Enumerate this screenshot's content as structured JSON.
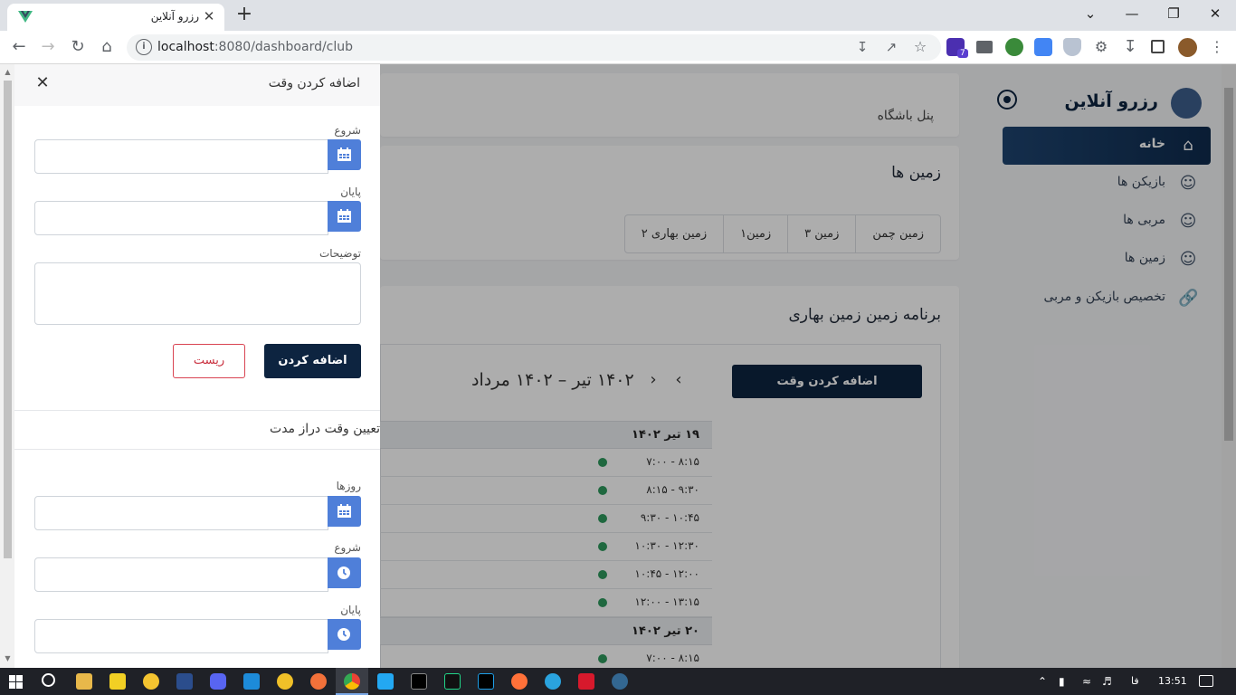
{
  "browser": {
    "tab_title": "رزرو آنلاین",
    "tab_close": "✕",
    "new_tab": "+",
    "url_host": "localhost",
    "url_rest": ":8080/dashboard/club",
    "window_controls": [
      "⌄",
      "—",
      "❐",
      "✕"
    ],
    "extension_badge": "7"
  },
  "sidebar": {
    "brand": "رزرو آنلاین",
    "items": [
      {
        "label": "خانه",
        "icon": "home-icon",
        "active": true
      },
      {
        "label": "بازیکن ها",
        "icon": "users-icon",
        "active": false
      },
      {
        "label": "مربی ها",
        "icon": "users-icon",
        "active": false
      },
      {
        "label": "زمین ها",
        "icon": "users-icon",
        "active": false
      },
      {
        "label": "تخصیص بازیکن و مربی",
        "icon": "link-icon",
        "active": false
      }
    ]
  },
  "main": {
    "panel_title": "پنل باشگاه",
    "fields_title": "زمین ها",
    "fields": [
      "زمین چمن",
      "زمین ۳",
      "زمین۱",
      "زمین بهاری ۲"
    ],
    "schedule_title": "برنامه زمین زمین بهاری",
    "add_time_button": "اضافه کردن وقت",
    "calendar_range": "۱۴۰۲ تیر – ۱۴۰۲ مرداد",
    "days": [
      {
        "date": "۱۹ تیر ۱۴۰۲",
        "slots": [
          "۷:۰۰ - ۸:۱۵",
          "۸:۱۵ - ۹:۳۰",
          "۹:۳۰ - ۱۰:۴۵",
          "۱۰:۳۰ - ۱۲:۳۰",
          "۱۰:۴۵ - ۱۲:۰۰",
          "۱۲:۰۰ - ۱۳:۱۵"
        ]
      },
      {
        "date": "۲۰ تیر ۱۴۰۲",
        "slots": [
          "۷:۰۰ - ۸:۱۵"
        ]
      }
    ],
    "slot_color": "#2e9a5e"
  },
  "drawer": {
    "title": "اضافه کردن وقت",
    "close": "✕",
    "start_label": "شروع",
    "end_label": "پایان",
    "desc_label": "توضیحات",
    "submit": "اضافه کردن",
    "reset": "ریست",
    "long_term_title": "تعیین وقت دراز مدت",
    "days_label": "روزها",
    "lt_start_label": "شروع",
    "lt_end_label": "پایان"
  },
  "taskbar": {
    "lang": "فا",
    "time": "13:51"
  },
  "colors": {
    "primary": "#0d2440",
    "picker": "#4f7fd9",
    "danger": "#c9303f"
  }
}
